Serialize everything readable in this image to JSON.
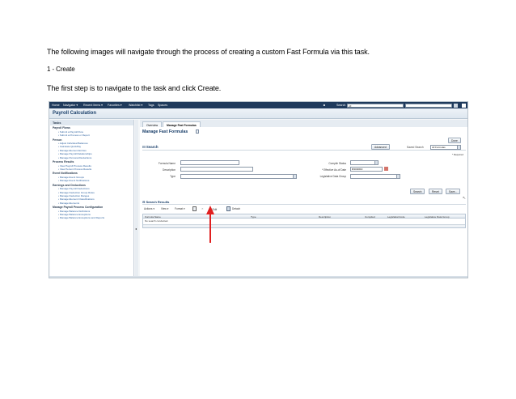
{
  "document": {
    "intro": "The following images will navigate through the process of creating a custom Fast Formula via this task.",
    "step_heading": "1 - Create",
    "first_step": "The first step is to navigate to the task and click Create."
  },
  "screenshot": {
    "topbar": {
      "home": "Home",
      "navigator": "Navigator ▾",
      "recent": "Recent Items ▾",
      "favorites": "Favorites ▾",
      "watchlist": "Watchlist ▾",
      "tags": "Tags",
      "spaces": "Spaces",
      "search_label": "Search",
      "search_value": "All"
    },
    "app_title": "Payroll Calculation",
    "tasks": {
      "header": "Tasks",
      "sections": [
        {
          "title": "Payroll Flows",
          "items": [
            "Submit a Payroll Flow",
            "Submit a Process or Report"
          ]
        },
        {
          "title": "Person",
          "items": [
            "Adjust Individual Balances",
            "Calculate QuickPay",
            "Manage Element Entries",
            "Manage Payroll Relationships",
            "Manage Personal Deductions"
          ]
        },
        {
          "title": "Process Results",
          "items": [
            "View Payroll Process Results",
            "View Person Process Results"
          ]
        },
        {
          "title": "Event Notifications",
          "items": [
            "Manage Event Groups",
            "Manage Event Notifications"
          ]
        },
        {
          "title": "Earnings and Deductions",
          "items": [
            "Manage Payroll Deductions",
            "Manage Deduction Group Rules",
            "Manage Deduction Ranges",
            "Manage Element Classifications",
            "Manage Elements"
          ]
        },
        {
          "title": "Manage Payroll Process Configuration",
          "items": [
            "Manage Balance Definitions",
            "Manage Balance Exceptions",
            "Manage Balance Exceptions and Reports"
          ]
        }
      ]
    },
    "tabs": [
      "Overview",
      "Manage Fast Formulas"
    ],
    "page_title": "Manage Fast Formulas",
    "done_label": "Done",
    "search": {
      "header": "Search",
      "advanced_label": "Advanced",
      "saved_search_label": "Saved Search",
      "saved_search_value": "All Formulas",
      "required_note": "* Required",
      "labels": {
        "formula_name": "Formula Name",
        "description": "Description",
        "type": "Type",
        "compile_status": "Compile Status",
        "effective_date": "* Effective As-of Date",
        "legislative_group": "Legislative Data Group"
      },
      "effective_date_value": "8/10/2013",
      "buttons": {
        "search": "Search",
        "reset": "Reset",
        "save": "Save..."
      }
    },
    "results": {
      "header": "Search Results",
      "toolbar": {
        "actions": "Actions ▾",
        "view": "View ▾",
        "format": "Format ▾",
        "edit": "Edit",
        "detach": "Detach"
      },
      "columns": [
        "Formula Name",
        "Type",
        "Description",
        "Compiled",
        "LegislationCode",
        "Legislative Data Group"
      ],
      "empty_text": "No search conducted."
    }
  }
}
